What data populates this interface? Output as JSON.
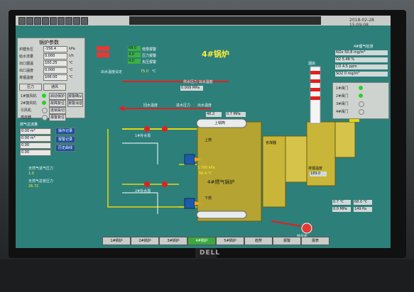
{
  "window": {
    "title_text": "2018-02-28 15:09:08",
    "top_left_text": "x"
  },
  "main_title": "4#锅炉",
  "left_panel": {
    "title": "锅炉参数",
    "rows": [
      {
        "label": "炉膛负压",
        "value": "-156.4",
        "unit": "kPa"
      },
      {
        "label": "给水流量",
        "value": "0.000",
        "unit": "t/h"
      },
      {
        "label": "出口烟温",
        "value": "100.25",
        "unit": "℃"
      },
      {
        "label": "出口温度",
        "value": "0.000",
        "unit": "℃"
      },
      {
        "label": "排烟温度",
        "value": "106.00",
        "unit": "℃"
      }
    ],
    "buttons": [
      "压力",
      "通风"
    ],
    "controls": [
      {
        "label": "1#鼓风机",
        "state": "运行"
      },
      {
        "label": "2#鼓风机",
        "state": "运行"
      },
      {
        "label": "引风机",
        "state": "运行"
      },
      {
        "label": "燃烧器",
        "state": "运行"
      },
      {
        "label": "1#循环泵",
        "state": "运行"
      },
      {
        "label": "2#循环泵",
        "state": "停止"
      }
    ],
    "cmd_buttons": [
      "启动保护",
      "故障复位",
      "连锁投切",
      "报警复位",
      "报警确认",
      "报警消音"
    ],
    "gas_section": {
      "title": "燃气总流量",
      "rows": [
        "0.00 m³",
        "0.00 m³",
        "0.00",
        "0.00"
      ],
      "buttons": [
        "操作记录",
        "报警记录",
        "历史曲线"
      ]
    },
    "gas_pressure": {
      "label": "天然气进气压力",
      "value": "1.0"
    },
    "big_value": {
      "label": "天然气总管压力",
      "value": "26.72"
    }
  },
  "top_indicators": [
    {
      "label": "68.0",
      "text": "低限报警"
    },
    {
      "label": "4.0",
      "text": "压力报警"
    },
    {
      "label": "4.0",
      "text": "负压报警"
    },
    {
      "label": "4.0",
      "text": "超温报警"
    }
  ],
  "setpoint": {
    "label": "出水温度设定",
    "value": "75.0",
    "unit": "℃"
  },
  "labels": {
    "water_in": "供水压力 出水温度",
    "inlet_pressure": "0.009 MPa",
    "return_temp": "回水温度",
    "out_pressure": "进水压力",
    "out_temp": "出水温度",
    "pipe_val1": "48.2",
    "pipe_val2": "0.7 MPa",
    "drum_label": "上锅筒",
    "drum_val": "4#燃气锅炉",
    "furnace_temp": "5.795 kPa",
    "furnace_t2": "56.4 ℃",
    "pump1": "1#补水泵",
    "pump2": "2#补水泵",
    "burner_top": "上燃",
    "burner_bot": "下燃",
    "fan_label": "鼓风机",
    "econ_label": "省煤器",
    "exhaust_label": "排烟温度",
    "exhaust_val": "189.0",
    "stack_label": "烟囱",
    "co_title": "4#烟气检测",
    "co_rows": [
      "NOx 50.8 mg/m³",
      "O2 5.48 %",
      "CO 4.5 ppm",
      "SO2 0 mg/m³"
    ],
    "right_ctrls": [
      "1#阀门",
      "2#阀门",
      "3#阀门",
      "4#阀门"
    ],
    "btm_vals": [
      "0.7 ℃",
      "0.0 MPa",
      "68.0 ℃",
      "149 Pa"
    ]
  },
  "bottom_tabs": [
    "1#锅炉",
    "2#锅炉",
    "3#锅炉",
    "4#锅炉",
    "5#锅炉",
    "趋势",
    "报警",
    "报表"
  ],
  "colors": {
    "screen": "#2d7f7a",
    "pipe_yellow": "#e8d70a",
    "pipe_red": "#e02020",
    "boiler": "#b5a432"
  },
  "brand": "DELL"
}
